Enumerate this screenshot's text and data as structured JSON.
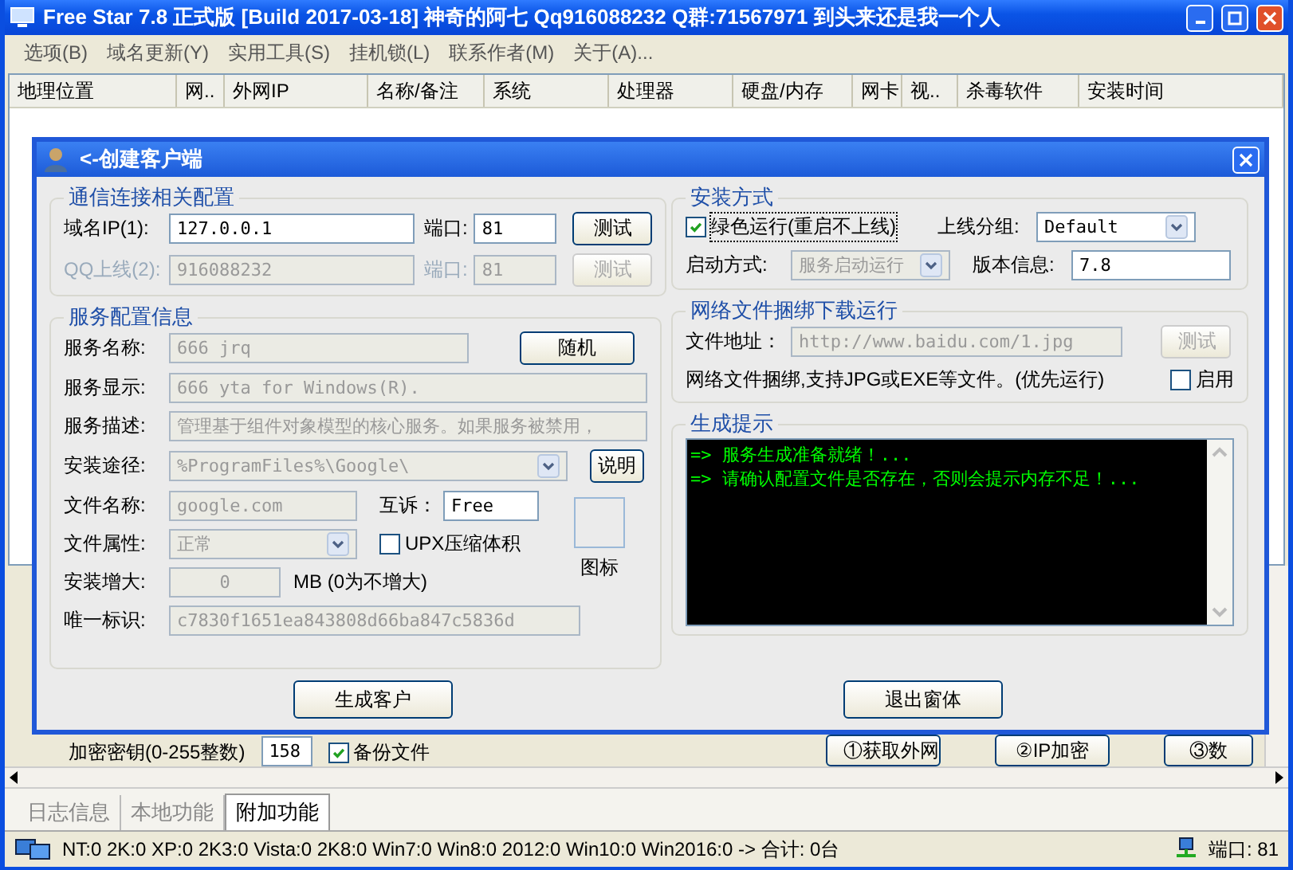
{
  "window": {
    "title": "Free Star 7.8 正式版 [Build 2017-03-18] 神奇的阿七  Qq916088232 Q群:71567971 到头来还是我一个人"
  },
  "menu": [
    "选项(B)",
    "域名更新(Y)",
    "实用工具(S)",
    "挂机锁(L)",
    "联系作者(M)",
    "关于(A)..."
  ],
  "columns": [
    "地理位置",
    "网..",
    "外网IP",
    "名称/备注",
    "系统",
    "处理器",
    "硬盘/内存",
    "网卡",
    "视..",
    "杀毒软件",
    "安装时间"
  ],
  "lower_panel": {
    "key_label": "加密密钥(0-255整数)",
    "key_value": "158",
    "backup": {
      "label": "备份文件",
      "checked": true
    },
    "buttons": [
      "①获取外网",
      "②IP加密",
      "③数"
    ]
  },
  "dialog": {
    "title": "<-创建客户端",
    "comm": {
      "title": "通信连接相关配置",
      "rows": [
        {
          "label": "域名IP(1):",
          "value": "127.0.0.1",
          "port_label": "端口:",
          "port": "81",
          "test": "测试",
          "disabled": false
        },
        {
          "label": "QQ上线(2):",
          "value": "916088232",
          "port_label": "端口:",
          "port": "81",
          "test": "测试",
          "disabled": true
        }
      ]
    },
    "service": {
      "title": "服务配置信息",
      "name": {
        "label": "服务名称:",
        "value": "666 jrq",
        "disabled": true
      },
      "random": "随机",
      "display": {
        "label": "服务显示:",
        "value": "666 yta for Windows(R).",
        "disabled": true
      },
      "desc": {
        "label": "服务描述:",
        "value": "管理基于组件对象模型的核心服务。如果服务被禁用，",
        "disabled": true
      },
      "path": {
        "label": "安装途径:",
        "value": "%ProgramFiles%\\Google\\",
        "disabled": true
      },
      "explain": "说明",
      "file": {
        "label": "文件名称:",
        "value": "google.com",
        "disabled": true
      },
      "mutex": {
        "label": "互诉：",
        "value": "Free",
        "disabled": false
      },
      "attr": {
        "label": "文件属性:",
        "value": "正常",
        "disabled": true
      },
      "upx": {
        "label": "UPX压缩体积",
        "checked": false
      },
      "icon_label": "图标",
      "size": {
        "label": "安装增大:",
        "value": "0",
        "disabled": true
      },
      "size_note": "MB (0为不增大)",
      "id": {
        "label": "唯一标识:",
        "value": "c7830f1651ea843808d66ba847c5836d",
        "disabled": true
      }
    },
    "install": {
      "title": "安装方式",
      "green": {
        "label": "绿色运行(重启不上线)",
        "checked": true
      },
      "group": {
        "label": "上线分组:",
        "value": "Default",
        "disabled": false
      },
      "start": {
        "label": "启动方式:",
        "value": "服务启动运行",
        "disabled": true
      },
      "version": {
        "label": "版本信息:",
        "value": "7.8",
        "disabled": false
      }
    },
    "bind": {
      "title": "网络文件捆绑下载运行",
      "url": {
        "label": "文件地址：",
        "value": "http://www.baidu.com/1.jpg",
        "disabled": true
      },
      "test": "测试",
      "note": "网络文件捆绑,支持JPG或EXE等文件。(优先运行)",
      "enable": {
        "label": "启用",
        "checked": false
      }
    },
    "log": {
      "title": "生成提示",
      "lines": [
        "=> 服务生成准备就绪！...",
        "=> 请确认配置文件是否存在，否则会提示内存不足！..."
      ]
    },
    "buttons": [
      "生成客户",
      "退出窗体"
    ]
  },
  "tabs": [
    {
      "label": "日志信息",
      "selected": false
    },
    {
      "label": "本地功能",
      "selected": false
    },
    {
      "label": "附加功能",
      "selected": true
    }
  ],
  "status_bar": {
    "counts": "NT:0  2K:0  XP:0  2K3:0  Vista:0  2K8:0  Win7:0  Win8:0  2012:0  Win10:0  Win2016:0  -> 合计: 0台",
    "port": "端口: 81"
  }
}
